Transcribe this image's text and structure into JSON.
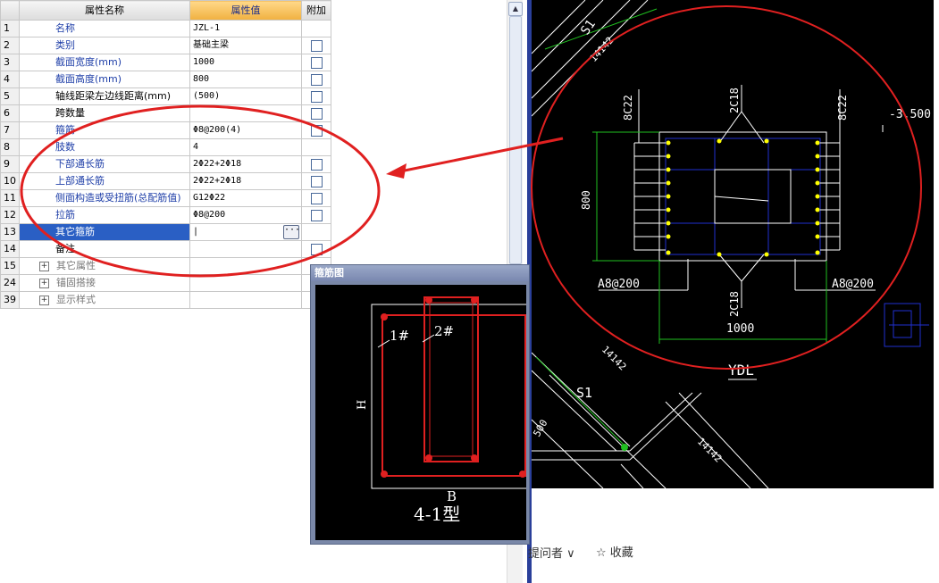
{
  "grid": {
    "headers": {
      "name": "属性名称",
      "value": "属性值",
      "extra": "附加"
    },
    "rows": [
      {
        "num": "1",
        "name": "名称",
        "value": "JZL-1"
      },
      {
        "num": "2",
        "name": "类别",
        "value": "基础主梁"
      },
      {
        "num": "3",
        "name": "截面宽度(mm)",
        "value": "1000"
      },
      {
        "num": "4",
        "name": "截面高度(mm)",
        "value": "800"
      },
      {
        "num": "5",
        "name": "轴线距梁左边线距离(mm)",
        "value": "(500)"
      },
      {
        "num": "6",
        "name": "跨数量",
        "value": ""
      },
      {
        "num": "7",
        "name": "箍筋",
        "value": "Φ8@200(4)"
      },
      {
        "num": "8",
        "name": "肢数",
        "value": "4"
      },
      {
        "num": "9",
        "name": "下部通长筋",
        "value": "2Φ22+2Φ18"
      },
      {
        "num": "10",
        "name": "上部通长筋",
        "value": "2Φ22+2Φ18"
      },
      {
        "num": "11",
        "name": "侧面构造或受扭筋(总配筋值)",
        "value": "G12Φ22"
      },
      {
        "num": "12",
        "name": "拉筋",
        "value": "Φ8@200"
      },
      {
        "num": "13",
        "name": "其它箍筋",
        "value": "|"
      },
      {
        "num": "14",
        "name": "备注",
        "value": ""
      },
      {
        "num": "15",
        "name": "其它属性",
        "value": ""
      },
      {
        "num": "24",
        "name": "锚固搭接",
        "value": ""
      },
      {
        "num": "39",
        "name": "显示样式",
        "value": ""
      }
    ],
    "ellipsis": "···",
    "expand": "+"
  },
  "dialog": {
    "title": "箍筋图",
    "label_1": "1#",
    "label_2": "2#",
    "h": "H",
    "b": "B",
    "type": "4-1型"
  },
  "cad": {
    "s1": "S1",
    "dim_14142": "14142",
    "dim_800": "800",
    "dim_1000": "1000",
    "top_bar": "2C18",
    "bottom_bar": "2C18",
    "side_left": "8C22",
    "side_right": "8C22",
    "stirrup_left": "A8@200",
    "stirrup_right": "A8@200",
    "elev": "-3.500",
    "ydl": "YDL",
    "dim_500": "500"
  },
  "footer": {
    "asker": "提问者 ∨",
    "favorite": "☆ 收藏"
  },
  "colors": {
    "annotation": "#e02020",
    "cad_line": "#ffffff",
    "cad_blue": "#2030d0",
    "cad_green": "#20c020",
    "rebar": "#ffff00"
  }
}
